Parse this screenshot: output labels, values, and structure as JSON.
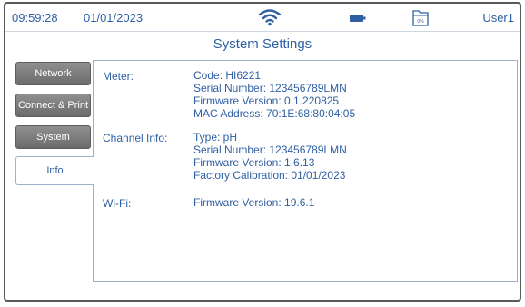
{
  "status_bar": {
    "time": "09:59:28",
    "date": "01/01/2023",
    "icons": [
      "wifi-icon",
      "battery-icon",
      "folder-icon"
    ],
    "storage_percent": "0%",
    "user": "User1"
  },
  "title": "System Settings",
  "tabs": [
    {
      "label": "Network",
      "active": false
    },
    {
      "label": "Connect & Print",
      "active": false
    },
    {
      "label": "System",
      "active": false
    },
    {
      "label": "Info",
      "active": true
    }
  ],
  "info": {
    "meter": {
      "label": "Meter:",
      "lines": [
        "Code: HI6221",
        "Serial Number: 123456789LMN",
        "Firmware Version: 0.1.220825",
        "MAC Address: 70:1E:68:80:04:05"
      ]
    },
    "channel": {
      "label": "Channel Info:",
      "lines": [
        "Type: pH",
        "Serial Number: 123456789LMN",
        "Firmware Version: 1.6.13",
        "Factory Calibration: 01/01/2023"
      ]
    },
    "wifi": {
      "label": "Wi-Fi:",
      "lines": [
        "Firmware Version: 19.6.1"
      ]
    }
  },
  "colors": {
    "text_blue": "#2e5fa3",
    "tab_gray": "#7a7a7a",
    "panel_border": "#9db1cc"
  }
}
